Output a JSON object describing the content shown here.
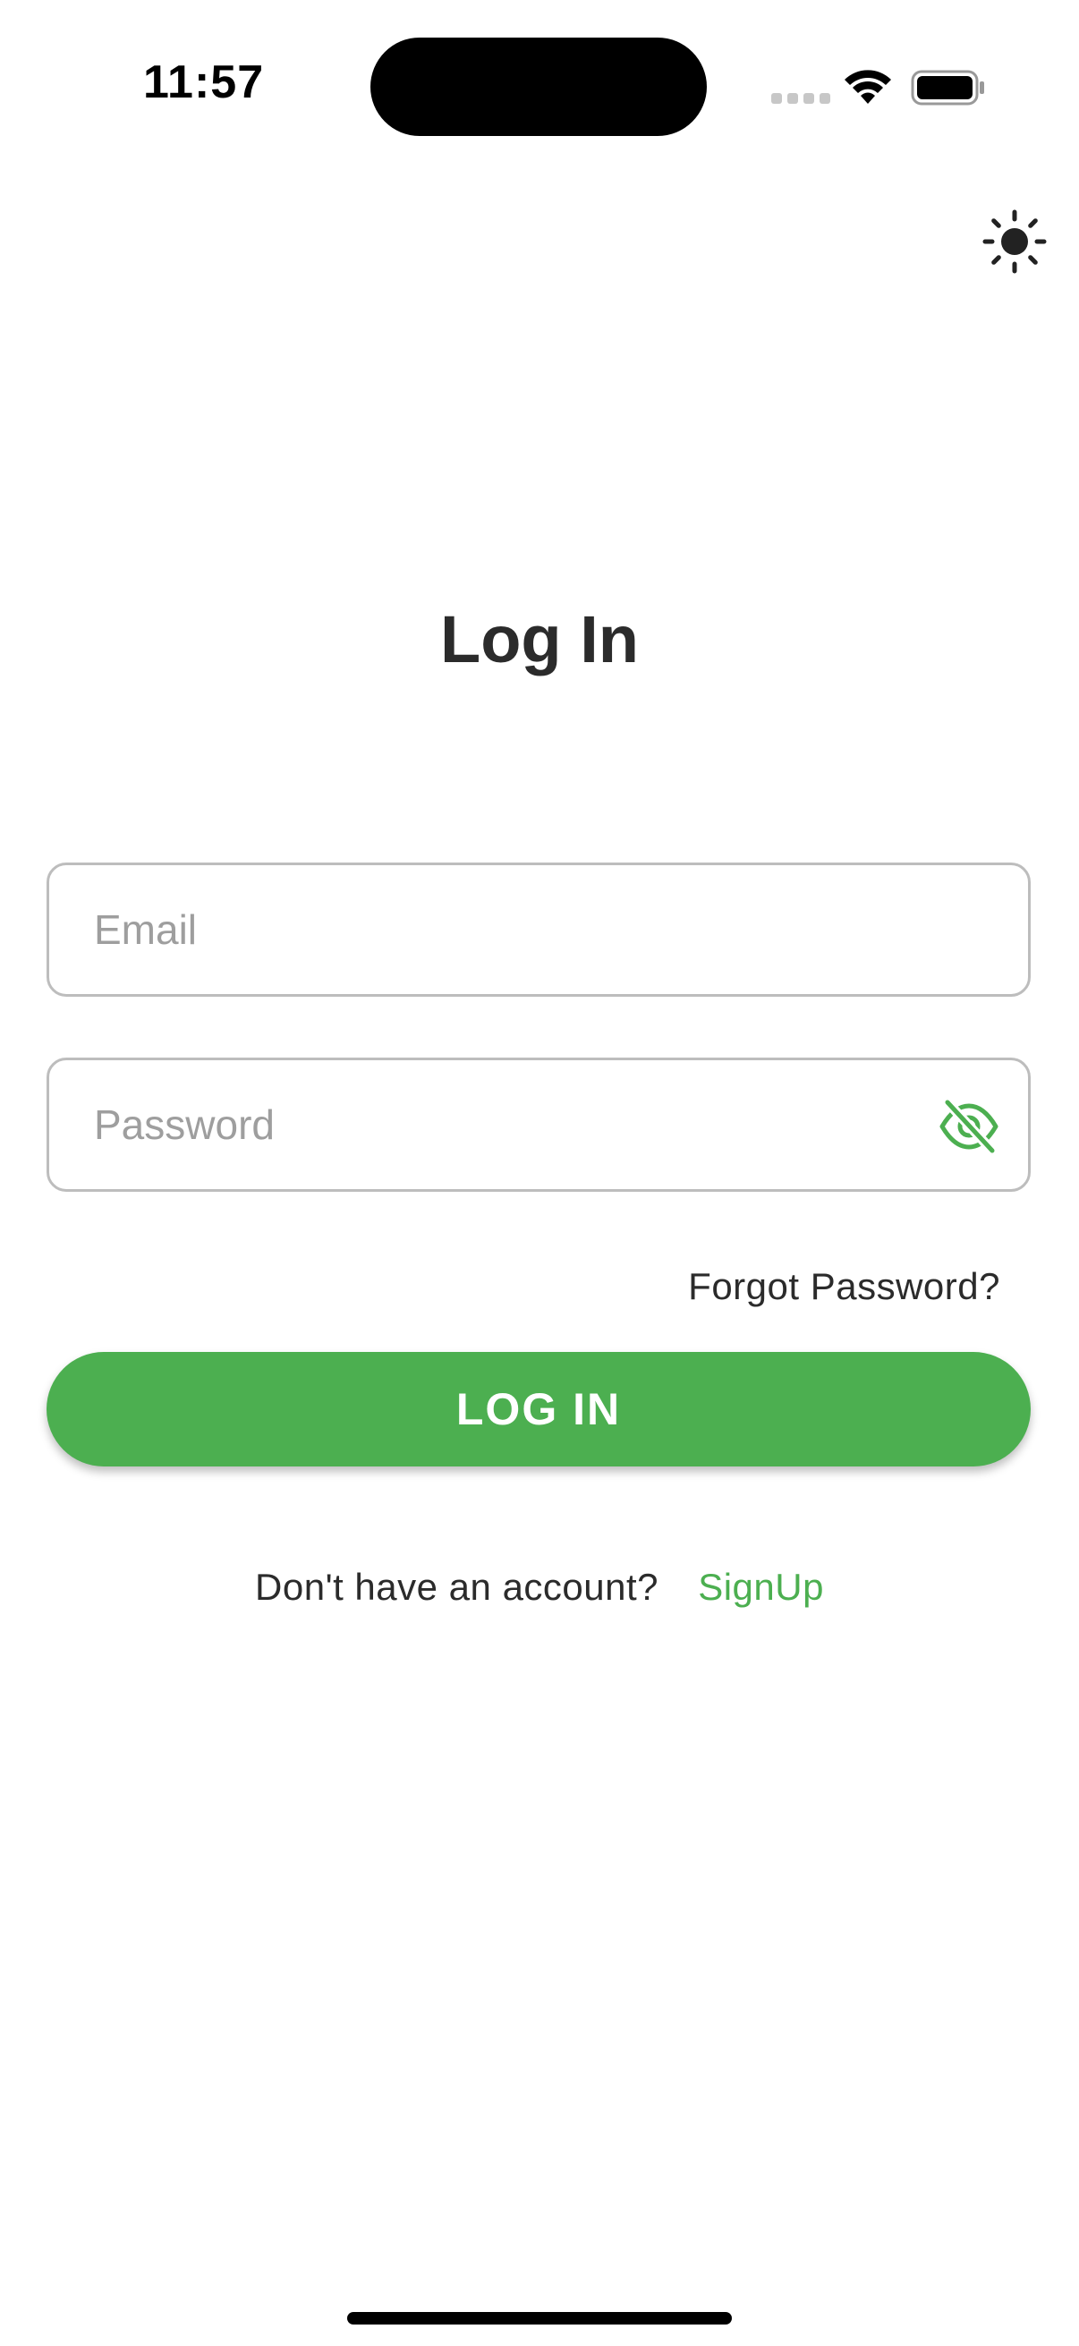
{
  "status_bar": {
    "time": "11:57",
    "icons": [
      "cellular-signal-icon",
      "wifi-icon",
      "battery-icon"
    ]
  },
  "header": {
    "theme_toggle_icon": "sun-icon"
  },
  "page": {
    "title": "Log In"
  },
  "form": {
    "email_placeholder": "Email",
    "email_value": "",
    "password_placeholder": "Password",
    "password_value": "",
    "password_visibility_icon": "eye-off-icon",
    "forgot_password": "Forgot Password?",
    "login_button": "LOG IN"
  },
  "signup": {
    "prompt": "Don't have an account?",
    "link": "SignUp"
  },
  "colors": {
    "accent": "#4caf50",
    "text": "#2b2b2b",
    "placeholder": "#9e9e9e",
    "border": "#bdbdbd",
    "background": "#ffffff"
  }
}
